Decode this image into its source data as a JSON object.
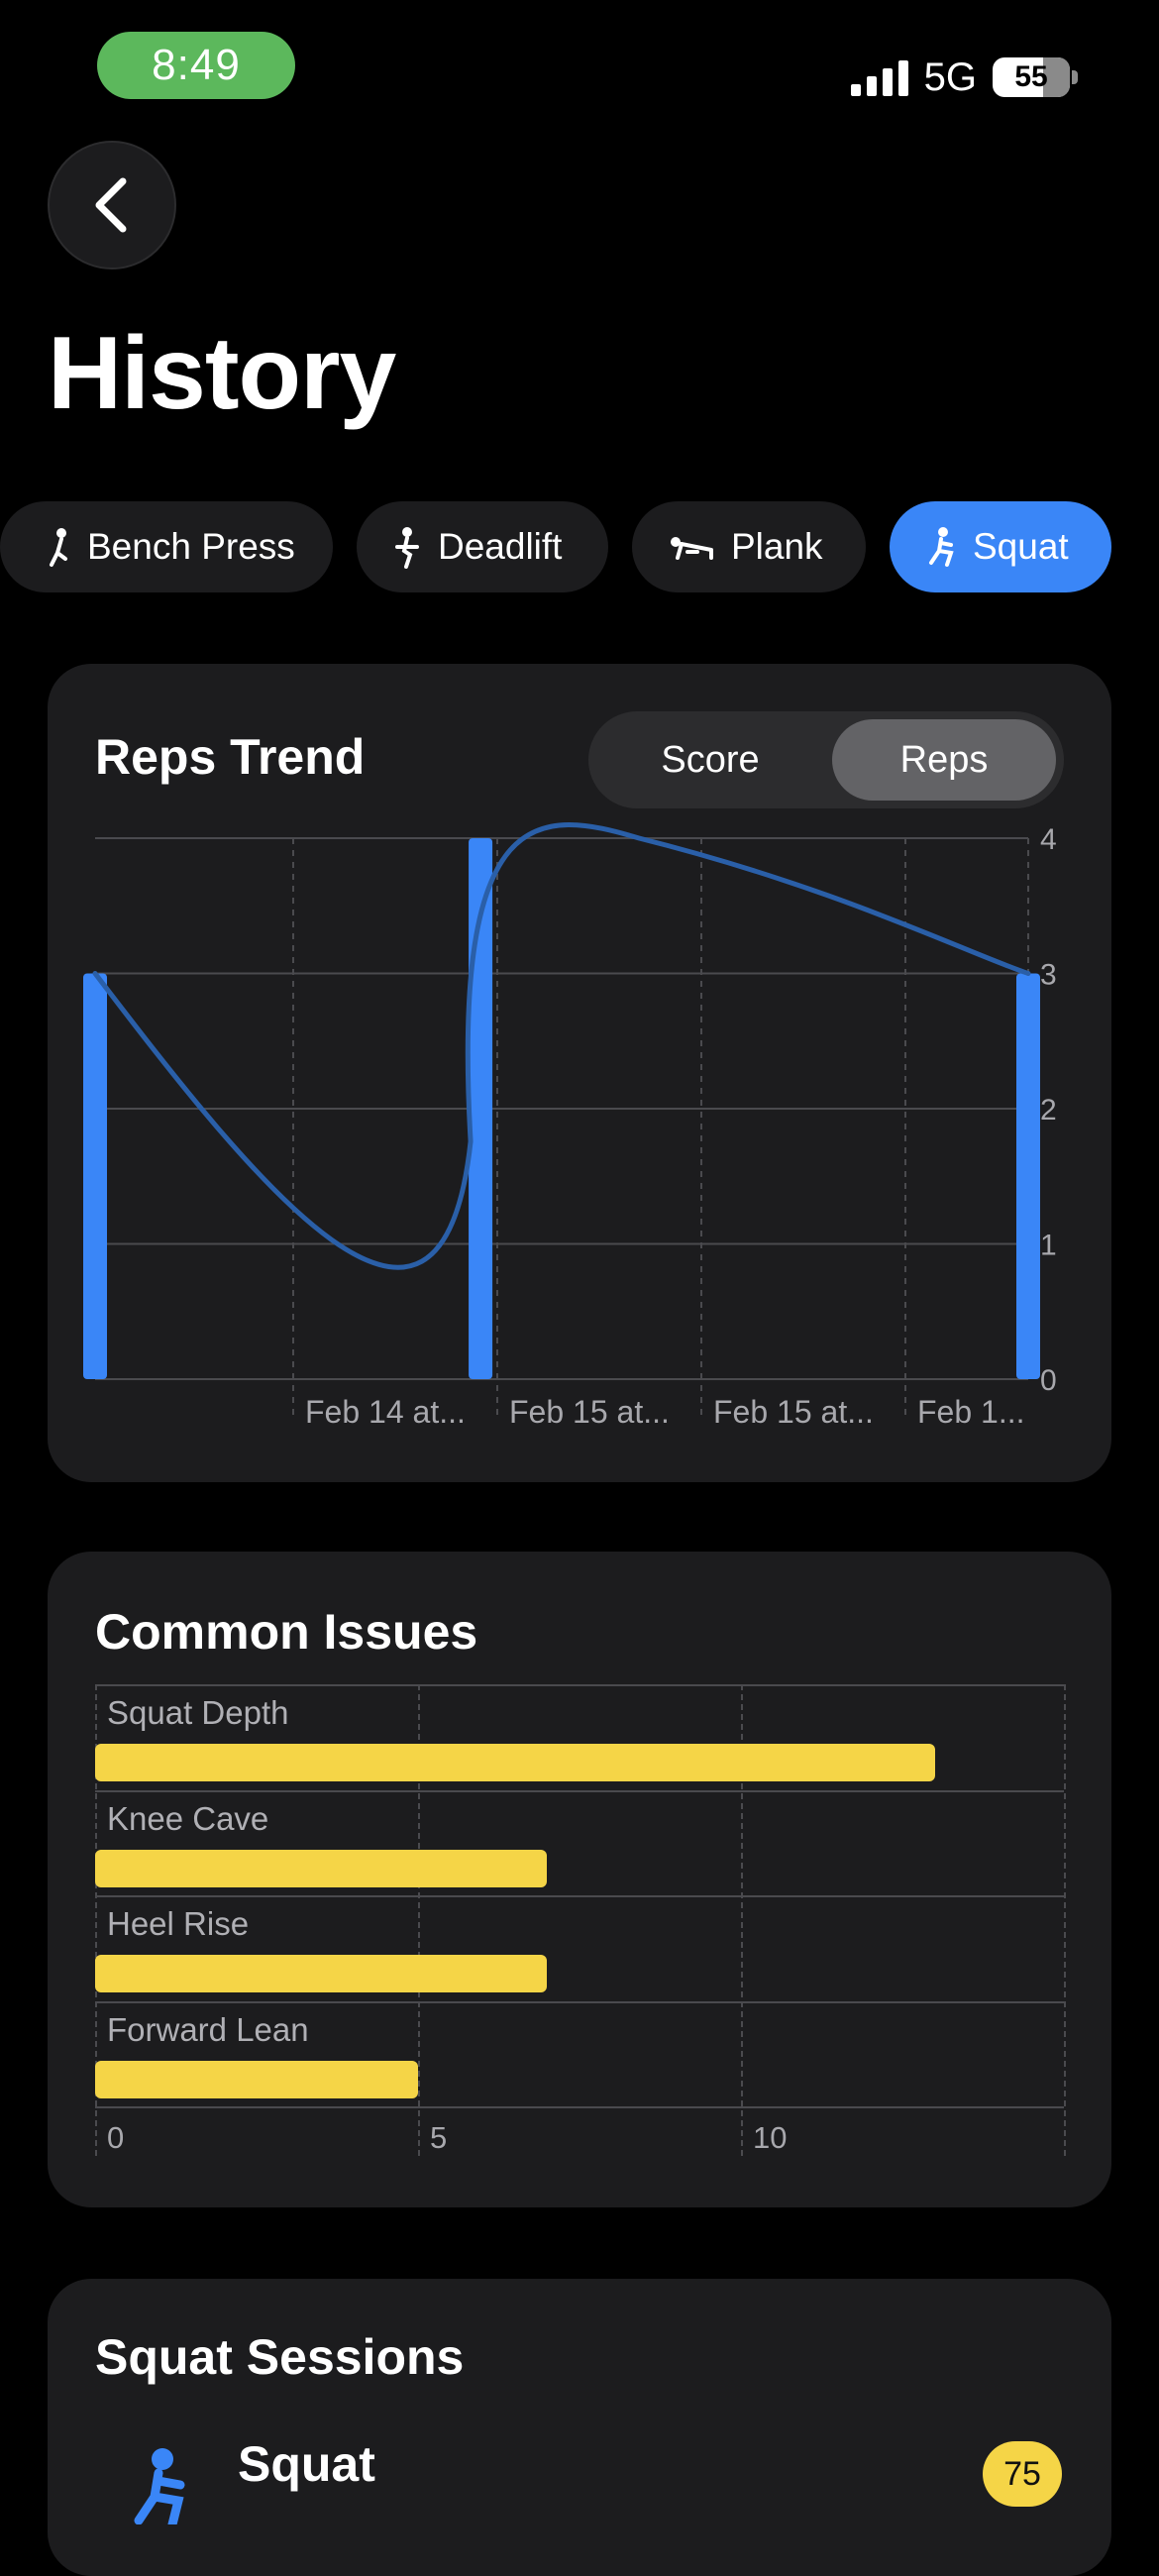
{
  "status_bar": {
    "time": "8:49",
    "network": "5G",
    "battery": "55"
  },
  "nav": {
    "title": "History"
  },
  "exercises": [
    {
      "label": "Bench Press",
      "icon": "bench-press-icon",
      "active": false
    },
    {
      "label": "Deadlift",
      "icon": "deadlift-icon",
      "active": false
    },
    {
      "label": "Plank",
      "icon": "plank-icon",
      "active": false
    },
    {
      "label": "Squat",
      "icon": "squat-icon",
      "active": true
    }
  ],
  "trend": {
    "title": "Reps Trend",
    "toggle": {
      "options": [
        "Score",
        "Reps"
      ],
      "selected": "Reps"
    }
  },
  "chart_data": [
    {
      "type": "bar",
      "title": "Reps Trend",
      "categories": [
        "Feb 14 at...",
        "Feb 15 at...",
        "Feb 15 at...",
        "Feb 1..."
      ],
      "series": [
        {
          "values": [
            3,
            4,
            3
          ]
        }
      ],
      "bar_positions": [
        0,
        1.9,
        4.6
      ],
      "line_overlay": true,
      "ylim": [
        0,
        4
      ],
      "yticks": [
        0,
        1,
        2,
        3,
        4
      ],
      "grid": true,
      "colors": {
        "bar": "#3a86f7",
        "line": "#2a5fa8"
      }
    },
    {
      "type": "bar",
      "orientation": "horizontal",
      "title": "Common Issues",
      "categories": [
        "Squat Depth",
        "Knee Cave",
        "Heel Rise",
        "Forward Lean"
      ],
      "values": [
        13,
        7,
        7,
        5
      ],
      "xlim": [
        0,
        15
      ],
      "xticks": [
        0,
        5,
        10
      ],
      "grid": true,
      "colors": {
        "bar": "#f5d547"
      }
    }
  ],
  "sessions": {
    "title": "Squat Sessions",
    "items": [
      {
        "name": "Squat",
        "score": "75",
        "icon": "squat-icon"
      }
    ]
  },
  "colors": {
    "accent": "#3a86f7",
    "card": "#1c1c1e",
    "warning": "#f5d547"
  }
}
